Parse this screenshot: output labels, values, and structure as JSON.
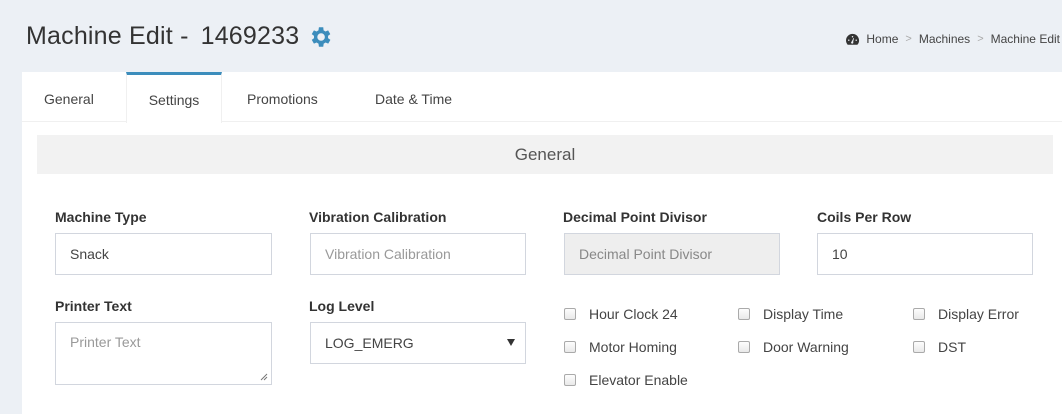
{
  "header": {
    "title": "Machine Edit -",
    "machine_id": "1469233"
  },
  "breadcrumb": {
    "items": [
      "Home",
      "Machines",
      "Machine Edit"
    ],
    "separator": ">"
  },
  "tabs": [
    {
      "label": "General",
      "active": false
    },
    {
      "label": "Settings",
      "active": true
    },
    {
      "label": "Promotions",
      "active": false
    },
    {
      "label": "Date & Time",
      "active": false
    }
  ],
  "section": {
    "title": "General"
  },
  "fields": {
    "machine_type": {
      "label": "Machine Type",
      "value": "Snack"
    },
    "vibration_calibration": {
      "label": "Vibration Calibration",
      "placeholder": "Vibration Calibration"
    },
    "decimal_point_divisor": {
      "label": "Decimal Point Divisor",
      "placeholder": "Decimal Point Divisor"
    },
    "coils_per_row": {
      "label": "Coils Per Row",
      "value": "10"
    },
    "printer_text": {
      "label": "Printer Text",
      "placeholder": "Printer Text"
    },
    "log_level": {
      "label": "Log Level",
      "value": "LOG_EMERG"
    }
  },
  "checkboxes": {
    "hour_clock_24": {
      "label": "Hour Clock 24",
      "checked": false
    },
    "display_time": {
      "label": "Display Time",
      "checked": false
    },
    "display_error": {
      "label": "Display Error",
      "checked": false
    },
    "motor_homing": {
      "label": "Motor Homing",
      "checked": false
    },
    "door_warning": {
      "label": "Door Warning",
      "checked": false
    },
    "dst": {
      "label": "DST",
      "checked": false
    },
    "elevator_enable": {
      "label": "Elevator Enable",
      "checked": false
    }
  },
  "colors": {
    "accent": "#3c8dbc",
    "page_bg": "#ecf0f5",
    "section_bg": "#f2f2f2"
  },
  "icons": {
    "title_icon": "gear-icon",
    "breadcrumb_icon": "dashboard-icon"
  }
}
